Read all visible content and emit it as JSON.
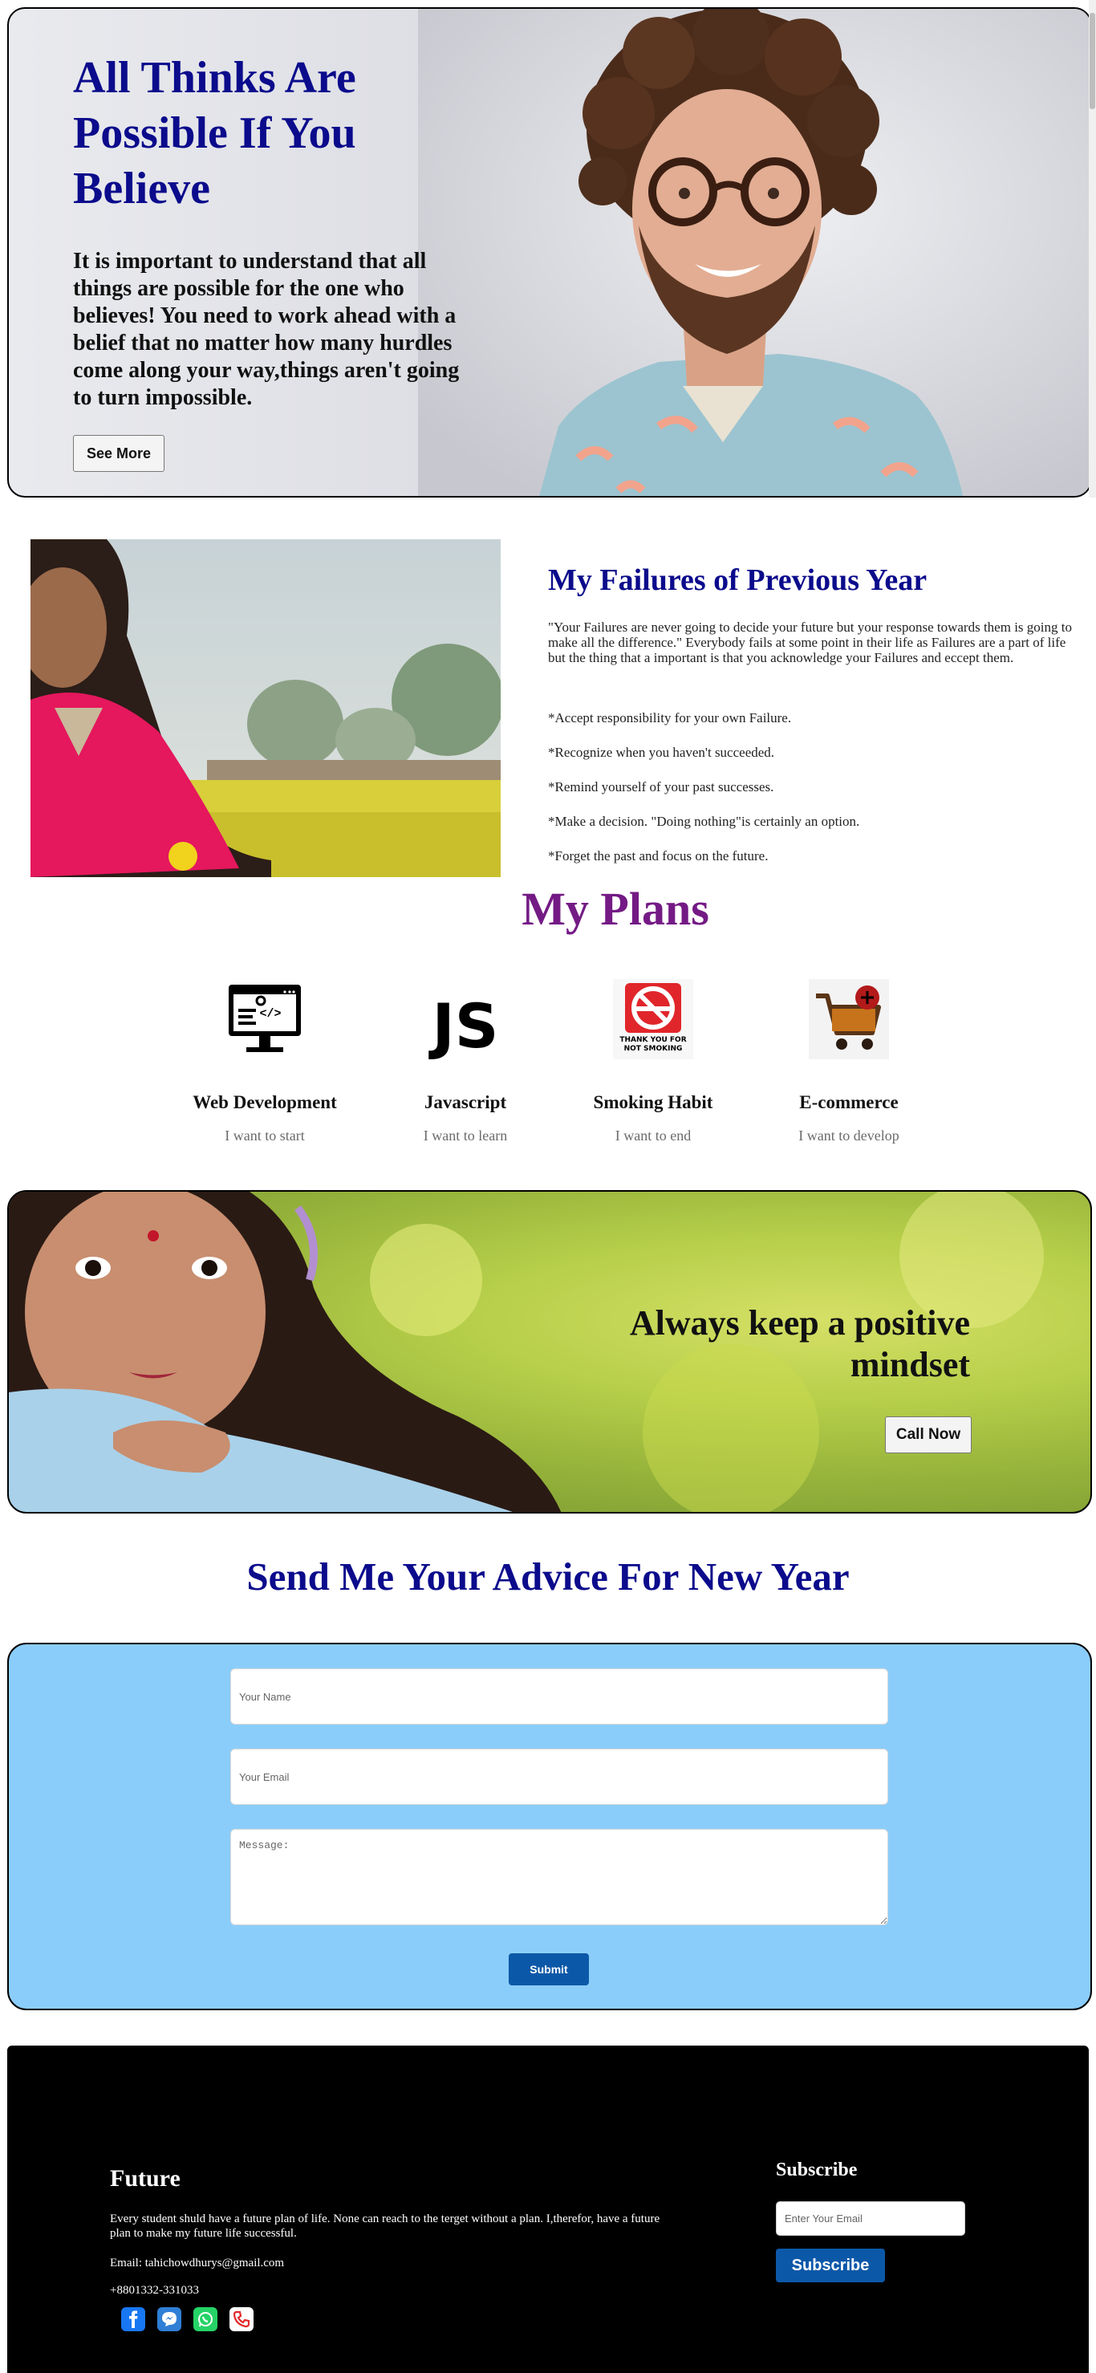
{
  "hero": {
    "title": "All Thinks Are Possible If You Believe",
    "text": "It is important to understand that all things are possible for the one who believes! You need to work ahead with a belief that no matter how many hurdles come along your way,things aren't going to turn impossible.",
    "button_label": "See More"
  },
  "failures": {
    "title": "My Failures of Previous Year",
    "quote": "\"Your Failures are never going to decide your future but your response towards them is going to make all the difference.\" Everybody fails at some point in their life as Failures are a part of life but the thing that a important is that you acknowledge your Failures and eccept them.",
    "items": [
      "*Accept responsibility for your own Failure.",
      "*Recognize when you haven't succeeded.",
      "*Remind yourself of your past successes.",
      "*Make a decision. \"Doing nothing\"is certainly an option.",
      "*Forget the past and focus on the future."
    ]
  },
  "plans": {
    "title": "My Plans",
    "items": [
      {
        "name": "Web Development",
        "sub": "I want to start",
        "icon": "web-development-icon"
      },
      {
        "name": "Javascript",
        "sub": "I want to learn",
        "icon": "javascript-icon",
        "icon_text": "JS"
      },
      {
        "name": "Smoking Habit",
        "sub": "I want to end",
        "icon": "no-smoking-icon",
        "icon_text": "THANK YOU FOR NOT SMOKING"
      },
      {
        "name": "E-commerce",
        "sub": "I want to develop",
        "icon": "shopping-cart-icon"
      }
    ]
  },
  "banner": {
    "title": "Always keep a positive mindset",
    "button_label": "Call Now"
  },
  "advice": {
    "title": "Send Me Your Advice For New Year",
    "name_placeholder": "Your Name",
    "email_placeholder": "Your Email",
    "message_placeholder": "Message:",
    "submit_label": "Submit"
  },
  "footer": {
    "title": "Future",
    "text": "Every student shuld have a future plan of life. None can reach to the terget without a plan. I,therefor, have a future plan to make my future life successful.",
    "email": "Email: tahichowdhurys@gmail.com",
    "phone": "+8801332-331033",
    "social": [
      "facebook-icon",
      "messenger-icon",
      "whatsapp-icon",
      "phone-icon"
    ],
    "subscribe_title": "Subscribe",
    "subscribe_placeholder": "Enter Your Email",
    "subscribe_button": "Subscribe"
  },
  "colors": {
    "accent_navy": "#0b0b8c",
    "plans_purple": "#741a85",
    "form_blue": "#8bcdfa",
    "button_blue": "#0c58a8"
  }
}
